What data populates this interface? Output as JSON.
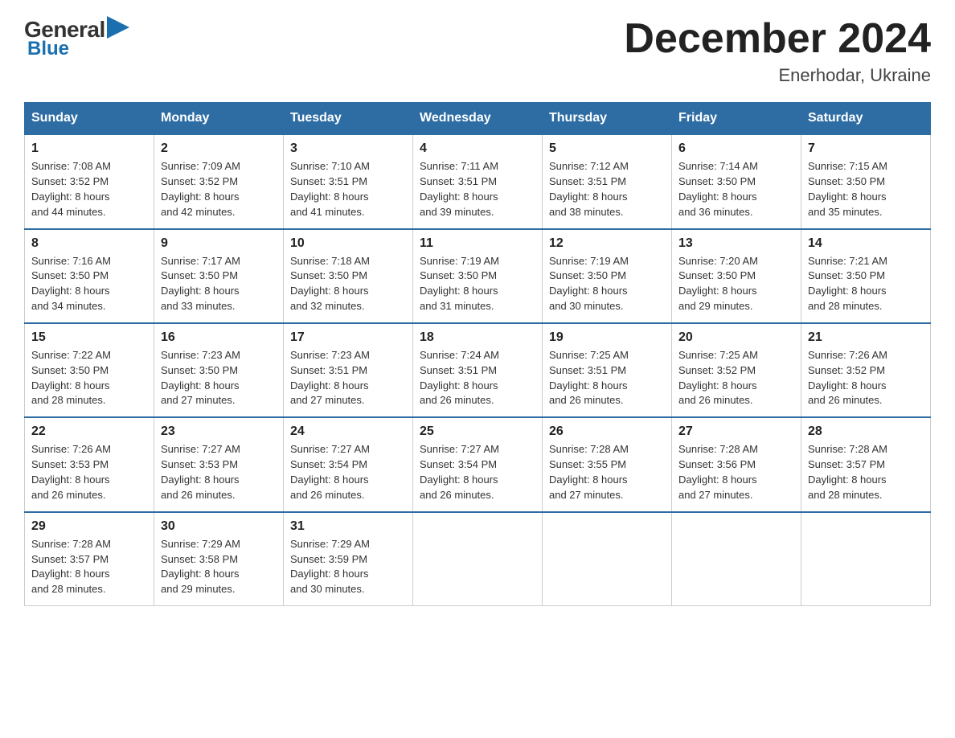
{
  "logo": {
    "general": "General",
    "blue": "Blue"
  },
  "title": "December 2024",
  "location": "Enerhodar, Ukraine",
  "days_of_week": [
    "Sunday",
    "Monday",
    "Tuesday",
    "Wednesday",
    "Thursday",
    "Friday",
    "Saturday"
  ],
  "weeks": [
    [
      {
        "day": "1",
        "sunrise": "7:08 AM",
        "sunset": "3:52 PM",
        "daylight": "8 hours and 44 minutes."
      },
      {
        "day": "2",
        "sunrise": "7:09 AM",
        "sunset": "3:52 PM",
        "daylight": "8 hours and 42 minutes."
      },
      {
        "day": "3",
        "sunrise": "7:10 AM",
        "sunset": "3:51 PM",
        "daylight": "8 hours and 41 minutes."
      },
      {
        "day": "4",
        "sunrise": "7:11 AM",
        "sunset": "3:51 PM",
        "daylight": "8 hours and 39 minutes."
      },
      {
        "day": "5",
        "sunrise": "7:12 AM",
        "sunset": "3:51 PM",
        "daylight": "8 hours and 38 minutes."
      },
      {
        "day": "6",
        "sunrise": "7:14 AM",
        "sunset": "3:50 PM",
        "daylight": "8 hours and 36 minutes."
      },
      {
        "day": "7",
        "sunrise": "7:15 AM",
        "sunset": "3:50 PM",
        "daylight": "8 hours and 35 minutes."
      }
    ],
    [
      {
        "day": "8",
        "sunrise": "7:16 AM",
        "sunset": "3:50 PM",
        "daylight": "8 hours and 34 minutes."
      },
      {
        "day": "9",
        "sunrise": "7:17 AM",
        "sunset": "3:50 PM",
        "daylight": "8 hours and 33 minutes."
      },
      {
        "day": "10",
        "sunrise": "7:18 AM",
        "sunset": "3:50 PM",
        "daylight": "8 hours and 32 minutes."
      },
      {
        "day": "11",
        "sunrise": "7:19 AM",
        "sunset": "3:50 PM",
        "daylight": "8 hours and 31 minutes."
      },
      {
        "day": "12",
        "sunrise": "7:19 AM",
        "sunset": "3:50 PM",
        "daylight": "8 hours and 30 minutes."
      },
      {
        "day": "13",
        "sunrise": "7:20 AM",
        "sunset": "3:50 PM",
        "daylight": "8 hours and 29 minutes."
      },
      {
        "day": "14",
        "sunrise": "7:21 AM",
        "sunset": "3:50 PM",
        "daylight": "8 hours and 28 minutes."
      }
    ],
    [
      {
        "day": "15",
        "sunrise": "7:22 AM",
        "sunset": "3:50 PM",
        "daylight": "8 hours and 28 minutes."
      },
      {
        "day": "16",
        "sunrise": "7:23 AM",
        "sunset": "3:50 PM",
        "daylight": "8 hours and 27 minutes."
      },
      {
        "day": "17",
        "sunrise": "7:23 AM",
        "sunset": "3:51 PM",
        "daylight": "8 hours and 27 minutes."
      },
      {
        "day": "18",
        "sunrise": "7:24 AM",
        "sunset": "3:51 PM",
        "daylight": "8 hours and 26 minutes."
      },
      {
        "day": "19",
        "sunrise": "7:25 AM",
        "sunset": "3:51 PM",
        "daylight": "8 hours and 26 minutes."
      },
      {
        "day": "20",
        "sunrise": "7:25 AM",
        "sunset": "3:52 PM",
        "daylight": "8 hours and 26 minutes."
      },
      {
        "day": "21",
        "sunrise": "7:26 AM",
        "sunset": "3:52 PM",
        "daylight": "8 hours and 26 minutes."
      }
    ],
    [
      {
        "day": "22",
        "sunrise": "7:26 AM",
        "sunset": "3:53 PM",
        "daylight": "8 hours and 26 minutes."
      },
      {
        "day": "23",
        "sunrise": "7:27 AM",
        "sunset": "3:53 PM",
        "daylight": "8 hours and 26 minutes."
      },
      {
        "day": "24",
        "sunrise": "7:27 AM",
        "sunset": "3:54 PM",
        "daylight": "8 hours and 26 minutes."
      },
      {
        "day": "25",
        "sunrise": "7:27 AM",
        "sunset": "3:54 PM",
        "daylight": "8 hours and 26 minutes."
      },
      {
        "day": "26",
        "sunrise": "7:28 AM",
        "sunset": "3:55 PM",
        "daylight": "8 hours and 27 minutes."
      },
      {
        "day": "27",
        "sunrise": "7:28 AM",
        "sunset": "3:56 PM",
        "daylight": "8 hours and 27 minutes."
      },
      {
        "day": "28",
        "sunrise": "7:28 AM",
        "sunset": "3:57 PM",
        "daylight": "8 hours and 28 minutes."
      }
    ],
    [
      {
        "day": "29",
        "sunrise": "7:28 AM",
        "sunset": "3:57 PM",
        "daylight": "8 hours and 28 minutes."
      },
      {
        "day": "30",
        "sunrise": "7:29 AM",
        "sunset": "3:58 PM",
        "daylight": "8 hours and 29 minutes."
      },
      {
        "day": "31",
        "sunrise": "7:29 AM",
        "sunset": "3:59 PM",
        "daylight": "8 hours and 30 minutes."
      },
      null,
      null,
      null,
      null
    ]
  ],
  "labels": {
    "sunrise": "Sunrise:",
    "sunset": "Sunset:",
    "daylight": "Daylight:"
  }
}
